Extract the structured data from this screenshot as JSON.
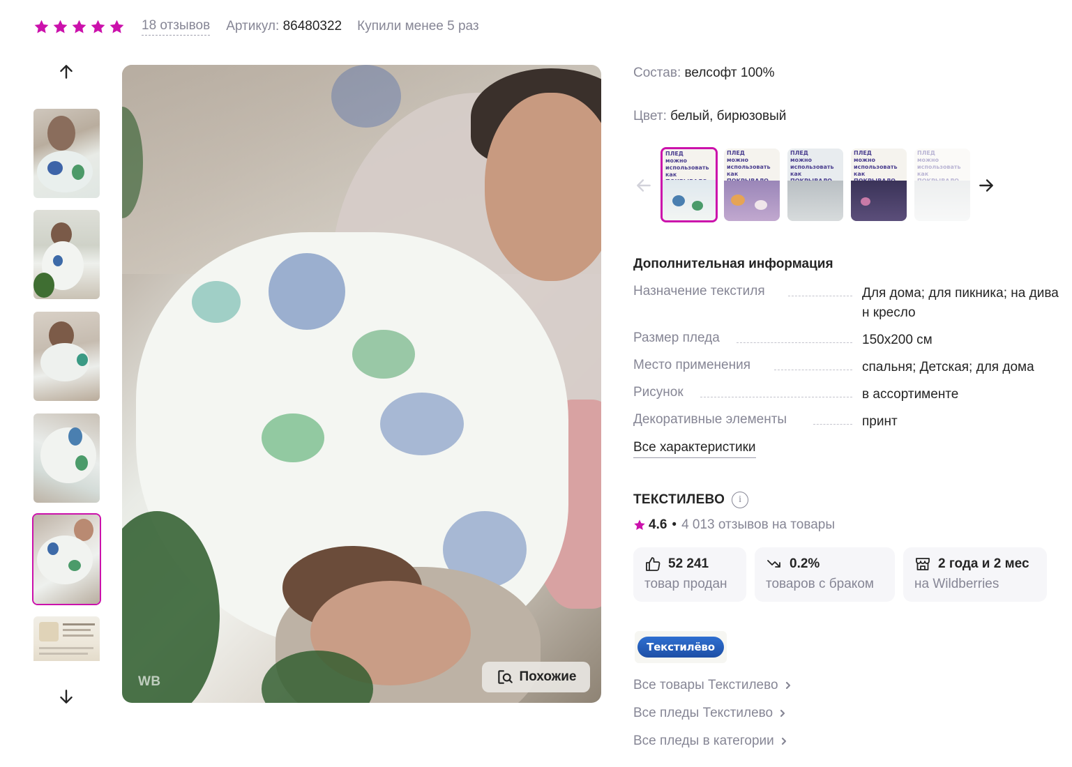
{
  "header": {
    "rating_stars": 5,
    "reviews_label": "18 отзывов",
    "article_label": "Артикул:",
    "article_value": "86480322",
    "bought_label": "Купили менее 5 раз"
  },
  "gallery": {
    "thumbnail_count": 6,
    "active_thumbnail": 5,
    "watermark": "WB",
    "similar_button_label": "Похожие"
  },
  "details": {
    "composition_label": "Состав:",
    "composition_value": "велсофт 100%",
    "color_label": "Цвет:",
    "color_value": "белый, бирюзовый",
    "color_variants": [
      {
        "caption": "ПЛЕД\nможно\nиспользовать\nкак\nПОКРЫВАЛО",
        "active": true
      },
      {
        "caption": "ПЛЕД\nможно\nиспользовать\nкак\nПОКРЫВАЛО",
        "active": false
      },
      {
        "caption": "ПЛЕД\nможно\nиспользовать\nкак\nПОКРЫВАЛО",
        "active": false
      },
      {
        "caption": "ПЛЕД\nможно\nиспользовать\nкак\nПОКРЫВАЛО",
        "active": false
      },
      {
        "caption": "ПЛЕД\nможно\nиспользовать\nкак\nПОКРЫВАЛО",
        "active": false
      }
    ]
  },
  "additional_info": {
    "title": "Дополнительная информация",
    "specs": [
      {
        "name": "Назначение текстиля",
        "value": "Для дома; для пикника; на диван кресло"
      },
      {
        "name": "Размер пледа",
        "value": "150х200 см"
      },
      {
        "name": "Место применения",
        "value": "спальня; Детская; для дома"
      },
      {
        "name": "Рисунок",
        "value": "в ассортименте"
      },
      {
        "name": "Декоративные элементы",
        "value": "принт"
      }
    ],
    "all_specs_link": "Все характеристики"
  },
  "seller": {
    "name": "ТЕКСТИЛЕВО",
    "info_icon_glyph": "i",
    "rating": "4.6",
    "separator": "•",
    "reviews": "4 013 отзывов на товары",
    "stats": [
      {
        "icon": "thumbs-up-icon",
        "value": "52 241",
        "label": "товар продан"
      },
      {
        "icon": "trend-down-icon",
        "value": "0.2%",
        "label": "товаров с браком"
      },
      {
        "icon": "store-icon",
        "value": "2 года и 2 мес",
        "label": "на Wildberries"
      }
    ],
    "logo_text": "Текстилёво",
    "links": [
      "Все товары Текстилево",
      "Все пледы Текстилево",
      "Все пледы в категории"
    ]
  },
  "colors": {
    "accent": "#cb11ab",
    "text_primary": "#242424",
    "text_secondary": "#868695",
    "card_bg": "#f6f6f9"
  }
}
